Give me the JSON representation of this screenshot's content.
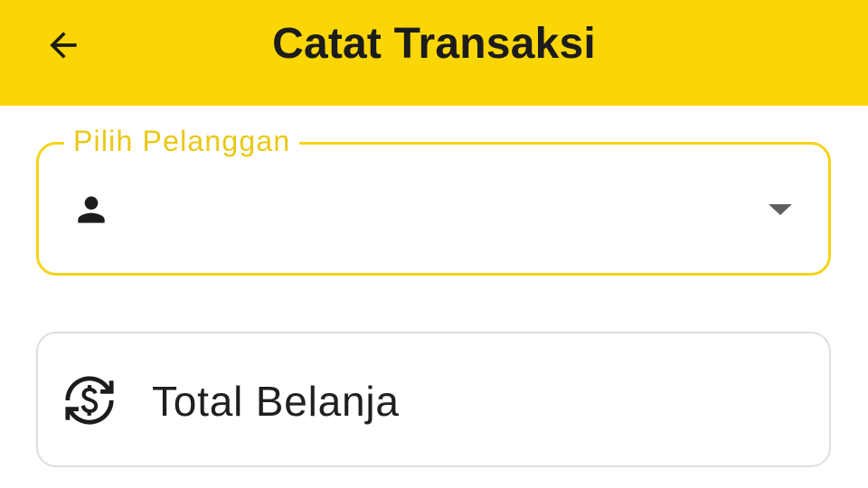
{
  "appbar": {
    "title": "Catat Transaksi",
    "back_icon": "arrow-left-icon",
    "background_color": "#FBD606"
  },
  "customer_field": {
    "label": "Pilih Pelanggan",
    "value": "",
    "leading_icon": "person-icon",
    "trailing_icon": "dropdown-arrow-icon",
    "accent_color": "#F5D318"
  },
  "total_card": {
    "label": "Total Belanja",
    "icon": "currency-exchange-icon"
  }
}
